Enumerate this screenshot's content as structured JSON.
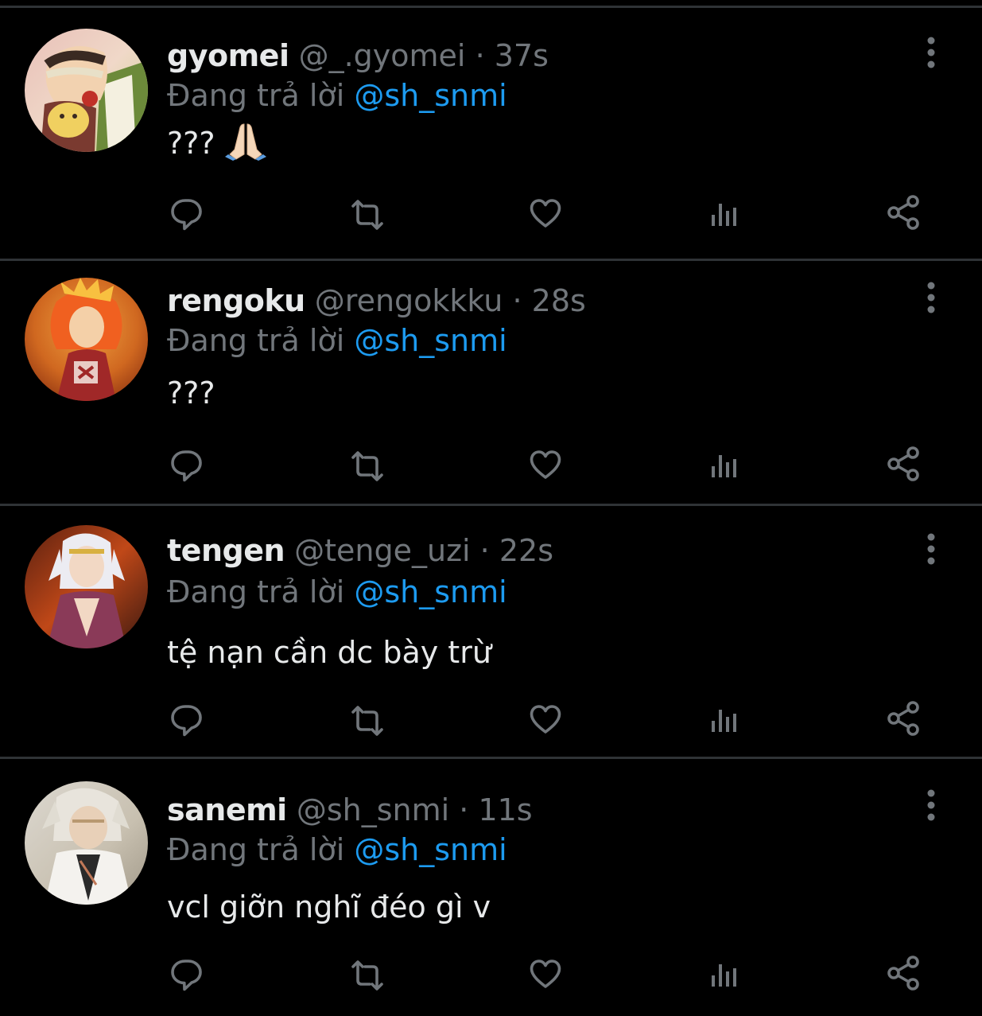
{
  "reply_prefix": "Đang trả lời",
  "colors": {
    "background": "#000000",
    "text": "#e7e9ea",
    "muted": "#71767b",
    "link": "#1d9bf0",
    "divider": "#2f3336"
  },
  "tweets": [
    {
      "display_name": "gyomei",
      "handle": "@_.gyomei",
      "separator": "·",
      "time": "37s",
      "reply_to": "@sh_snmi",
      "text": "???",
      "emoji": "folded-hands-emoji"
    },
    {
      "display_name": "rengoku",
      "handle": "@rengokkku",
      "separator": "·",
      "time": "28s",
      "reply_to": "@sh_snmi",
      "text": "???"
    },
    {
      "display_name": "tengen",
      "handle": "@tenge_uzi",
      "separator": "·",
      "time": "22s",
      "reply_to": "@sh_snmi",
      "text": "tệ nạn cần dc bày trừ"
    },
    {
      "display_name": "sanemi",
      "handle": "@sh_snmi",
      "separator": "·",
      "time": "11s",
      "reply_to": "@sh_snmi",
      "text": "vcl giỡn nghĩ đéo gì v"
    }
  ],
  "actions": [
    "reply-icon",
    "retweet-icon",
    "like-icon",
    "views-icon",
    "share-icon"
  ]
}
